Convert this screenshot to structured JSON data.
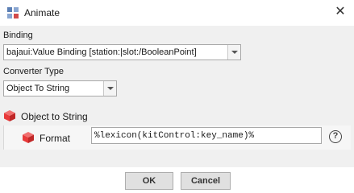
{
  "window": {
    "title": "Animate",
    "close_glyph": "✕"
  },
  "binding": {
    "label": "Binding",
    "value": "bajaui:Value Binding [station:|slot:/BooleanPoint]"
  },
  "converter_type": {
    "label": "Converter Type",
    "value": "Object To String"
  },
  "converter": {
    "header": "Object to String",
    "property_label": "Format",
    "property_value": "%lexicon(kitControl:key_name)%",
    "help_glyph": "?"
  },
  "buttons": {
    "ok": "OK",
    "cancel": "Cancel"
  },
  "colors": {
    "cube_icon": "#e83a3a",
    "panel_bg": "#f0f0f0"
  }
}
